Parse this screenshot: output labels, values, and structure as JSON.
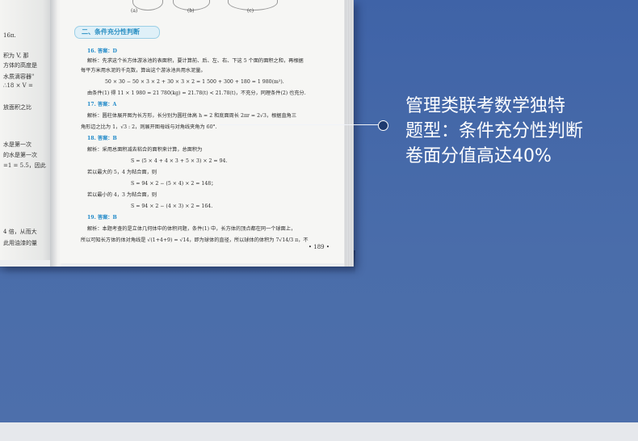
{
  "colors": {
    "background": "#4a6ba8",
    "accent": "#1e88c8",
    "bottom_band": "#e6e8ec"
  },
  "figure_labels": [
    "(a)",
    "(b)",
    "(c)"
  ],
  "left_page_lines": [
    "16π.",
    "积为 V, 那",
    "方体的高度是",
    "水质滴容器\"",
    "∴18 × V =",
    "放面积之比",
    "水是第一次",
    "的水是第一次",
    "=1 = 5.5，因此",
    "4 倍，从而大",
    "此用油漆的量"
  ],
  "section_title": "二、条件充分性判断",
  "q16": {
    "head": "16. 答案：D",
    "lines": [
      "解析：先求这个长方体游泳池的表面积，要计算前、后、左、右、下这 5 个面的面积之和，再根据",
      "每平方米用水泥的千克数，算出这个游泳池共用水泥量。",
      "50 × 30 − 50 × 3 × 2 + 30 × 3 × 2 = 1 500 + 300 + 180 = 1 980(m²).",
      "由条件(1) 得 11 × 1 980 = 21 780(kg) = 21.78(t) < 21.78(t)，不充分，同理条件(2) 也充分."
    ]
  },
  "q17": {
    "head": "17. 答案：A",
    "lines": [
      "解析：圆柱体展开图为长方形，长分别为圆柱体高 h = 2 和底面周长 2πr = 2√3，根据直角三",
      "角形边之比为 1，√3 : 2，则展开图母线与对角线夹角为 60°."
    ]
  },
  "q18": {
    "head": "18. 答案：B",
    "lines": [
      "解析：采用总面积减去粘合的面积来计算，总面积为",
      "S = (5 × 4 + 4 × 3 + 5 × 3) × 2 = 94.",
      "若以最大的 5，4 为粘合面，则",
      "S = 94 × 2 − (5 × 4) × 2 = 148；",
      "若以最小的 4，3 为粘合面，则",
      "S = 94 × 2 − (4 × 3) × 2 = 164."
    ]
  },
  "q19": {
    "head": "19. 答案：B",
    "lines": [
      "解析：本题考查的是立体几何体中的体积问题，条件(1) 中，长方体的顶点都在同一个球面上，",
      "所以可知长方体的体对角线是 √(1+4+9) = √14，即为球体的直径，所以球体的体积为 7√14/3 π，不"
    ]
  },
  "page_number": "• 189 •",
  "callout": {
    "line1": "管理类联考数学独特",
    "line2": "题型：条件充分性判断",
    "line3": "卷面分值高达40%"
  }
}
